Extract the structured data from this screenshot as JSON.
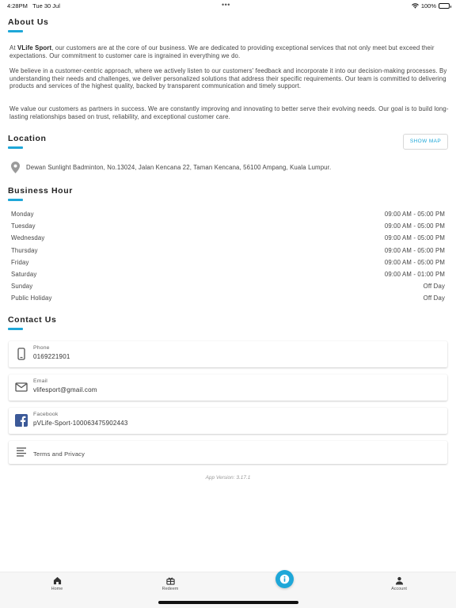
{
  "status_bar": {
    "time": "4:28PM",
    "date": "Tue 30 Jul",
    "battery": "100%"
  },
  "about": {
    "title": "About Us",
    "p1_prefix": "At ",
    "p1_brand": "VLife Sport",
    "p1_rest": ", our customers are at the core of our business. We are dedicated to providing exceptional services that not only meet but exceed their expectations. Our commitment to customer care is ingrained in everything we do.",
    "p2": "We believe in a customer-centric approach, where we actively listen to our customers' feedback and incorporate it into our decision-making processes. By understanding their needs and challenges, we deliver personalized solutions that address their specific requirements. Our team is committed to delivering products and services of the highest quality, backed by transparent communication and timely support.",
    "p3": "We value our customers as partners in success. We are constantly improving and innovating to better serve their evolving needs. Our goal is to build long-lasting relationships based on trust, reliability, and exceptional customer care."
  },
  "location": {
    "title": "Location",
    "show_map_label": "SHOW MAP",
    "address": "Dewan Sunlight Badminton, No.13024, Jalan Kencana 22, Taman Kencana, 56100 Ampang, Kuala Lumpur."
  },
  "business_hours": {
    "title": "Business Hour",
    "rows": [
      {
        "day": "Monday",
        "time": "09:00 AM - 05:00 PM"
      },
      {
        "day": "Tuesday",
        "time": "09:00 AM - 05:00 PM"
      },
      {
        "day": "Wednesday",
        "time": "09:00 AM - 05:00 PM"
      },
      {
        "day": "Thursday",
        "time": "09:00 AM - 05:00 PM"
      },
      {
        "day": "Friday",
        "time": "09:00 AM - 05:00 PM"
      },
      {
        "day": "Saturday",
        "time": "09:00 AM - 01:00 PM"
      },
      {
        "day": "Sunday",
        "time": "Off Day"
      },
      {
        "day": "Public Holiday",
        "time": "Off Day"
      }
    ]
  },
  "contact": {
    "title": "Contact Us",
    "phone": {
      "label": "Phone",
      "value": "0169221901",
      "icon": "phone-icon"
    },
    "email": {
      "label": "Email",
      "value": "vlifesport@gmail.com",
      "icon": "mail-icon"
    },
    "facebook": {
      "label": "Facebook",
      "value": "pVLife-Sport-100063475902443",
      "icon": "facebook-icon"
    },
    "terms": {
      "label": "Terms and Privacy",
      "icon": "document-lines-icon"
    }
  },
  "app_version": "App Version: 3.17.1",
  "bottom_nav": {
    "home": "Home",
    "redeem": "Redeem",
    "account": "Account"
  },
  "colors": {
    "accent": "#1ea7d8",
    "facebook": "#3b5998"
  }
}
